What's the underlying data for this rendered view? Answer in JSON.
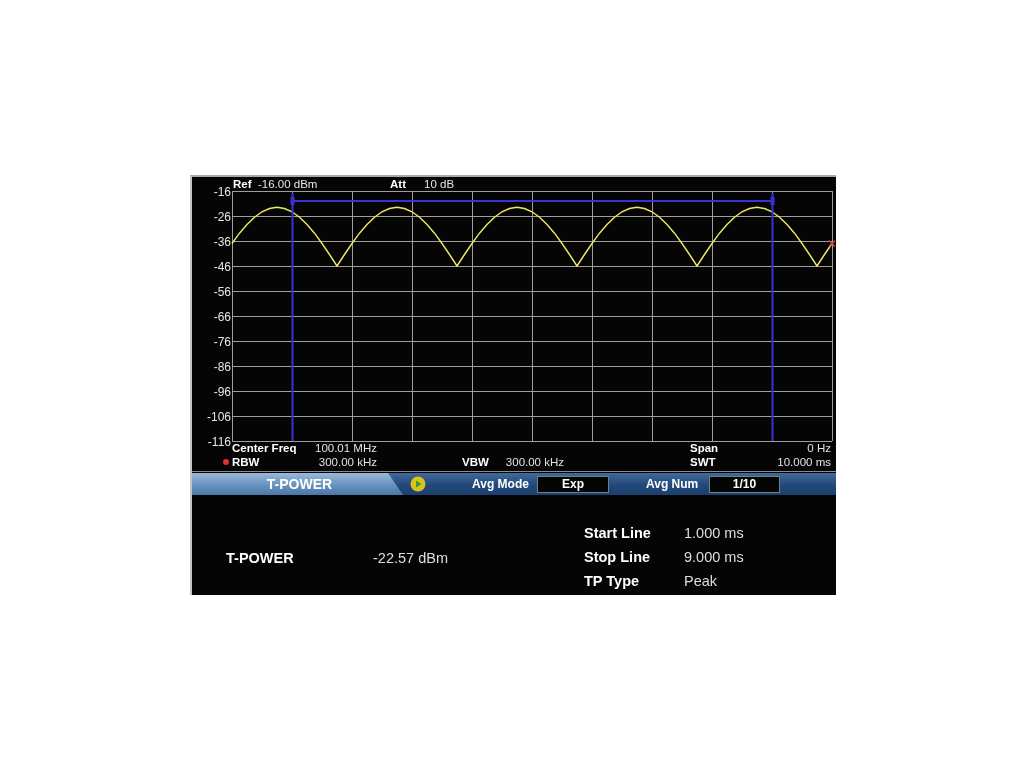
{
  "display": {
    "header": [
      {
        "label": "Ref",
        "value": "-16.00 dBm"
      },
      {
        "label": "Att",
        "value": "10 dB"
      }
    ],
    "chart_data": {
      "type": "line",
      "grid": true,
      "categories": [
        null,
        null,
        null,
        null,
        null,
        null,
        null,
        null,
        null,
        null,
        null,
        null,
        null,
        null,
        null,
        null,
        null,
        null,
        null,
        null,
        null,
        null,
        null,
        null,
        null,
        null,
        null,
        null,
        null,
        null,
        null,
        null,
        null,
        null,
        null,
        null,
        null,
        null,
        null,
        null,
        null,
        null,
        null,
        null,
        null,
        null,
        null,
        null,
        null,
        null,
        null,
        null,
        null,
        null,
        null,
        null,
        null,
        null,
        null,
        null,
        null,
        null,
        null,
        null,
        null,
        null,
        null,
        null,
        null,
        null,
        null,
        null,
        null,
        null,
        null,
        null,
        null,
        null,
        null,
        null,
        null
      ],
      "series": [
        {
          "color": "#efe866",
          "values": [
            -37,
            -32.9,
            -29.4,
            -26.5,
            -24.3,
            -23,
            -22.5,
            -23,
            -24.3,
            -26.5,
            -29.4,
            -32.9,
            -37,
            -41.4,
            -46,
            -41.4,
            -37,
            -32.9,
            -29.4,
            -26.5,
            -24.3,
            -23,
            -22.5,
            -23,
            -24.3,
            -26.5,
            -29.4,
            -32.9,
            -37,
            -41.4,
            -46,
            -41.4,
            -37,
            -32.9,
            -29.4,
            -26.5,
            -24.3,
            -23,
            -22.5,
            -23,
            -24.3,
            -26.5,
            -29.4,
            -32.9,
            -37,
            -41.4,
            -46,
            -41.4,
            -37,
            -32.9,
            -29.4,
            -26.5,
            -24.3,
            -23,
            -22.5,
            -23,
            -24.3,
            -26.5,
            -29.4,
            -32.9,
            -37,
            -41.4,
            -46,
            -41.4,
            -37,
            -32.9,
            -29.4,
            -26.5,
            -24.3,
            -23,
            -22.5,
            -23,
            -24.3,
            -26.5,
            -29.4,
            -32.9,
            -37,
            -41.4,
            -46,
            -41.4,
            -37
          ]
        }
      ],
      "ylim": [
        -116,
        -16
      ],
      "yticks": [
        -16,
        -26,
        -36,
        -46,
        -56,
        -66,
        -76,
        -86,
        -96,
        -106,
        -116
      ]
    },
    "readout_rows": [
      [
        {
          "label": "Center Freq",
          "value": "100.01 MHz",
          "manual": false
        },
        {
          "label": "Span",
          "value": "0 Hz",
          "manual": false
        }
      ],
      [
        {
          "label": "RBW",
          "value": "300.00 kHz",
          "manual": true
        },
        {
          "label": "VBW",
          "value": "300.00 kHz",
          "manual": false
        },
        {
          "label": "SWT",
          "value": "10.000 ms",
          "manual": false
        }
      ]
    ]
  },
  "menu_bar": {
    "title": "T-POWER",
    "fields": [
      {
        "label": "Avg Mode",
        "value": "Exp"
      },
      {
        "label": "Avg Num",
        "value": "1/10"
      }
    ]
  },
  "results": {
    "measurement": {
      "label": "T-POWER",
      "value": "-22.57 dBm"
    },
    "parameters": [
      {
        "label": "Start Line",
        "value": "1.000 ms"
      },
      {
        "label": "Stop Line",
        "value": "9.000 ms"
      },
      {
        "label": "TP Type",
        "value": "Peak"
      }
    ]
  }
}
